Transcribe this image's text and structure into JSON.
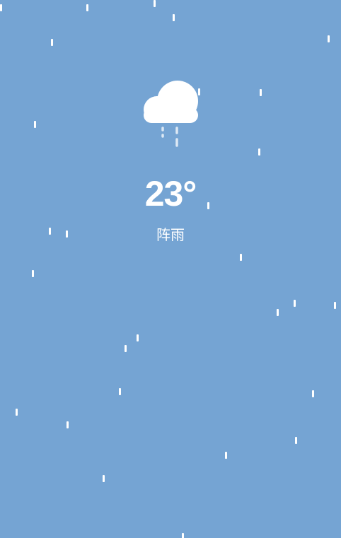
{
  "theme": {
    "background": "#75a4d3",
    "text_color": "#ffffff",
    "cloud_color": "#ffffff",
    "rain_color": "#ffffff"
  },
  "weather": {
    "icon": "rain-cloud-icon",
    "temperature": "23°",
    "condition": "阵雨"
  }
}
